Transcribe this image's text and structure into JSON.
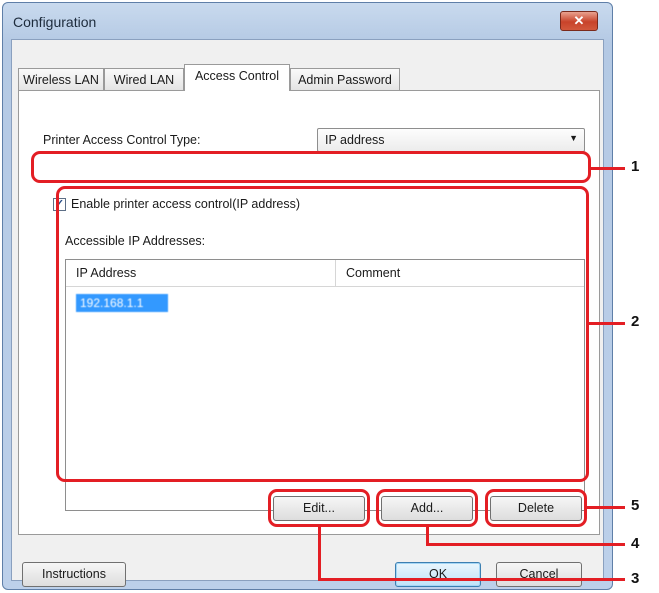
{
  "window": {
    "title": "Configuration",
    "close_glyph": "✕"
  },
  "tabs": [
    {
      "label": "Wireless LAN"
    },
    {
      "label": "Wired LAN"
    },
    {
      "label": "Access Control",
      "active": true
    },
    {
      "label": "Admin Password"
    }
  ],
  "access": {
    "type_label": "Printer Access Control Type:",
    "type_value": "IP address",
    "enable_label": "Enable printer access control(IP address)",
    "enable_checked": true,
    "list_label": "Accessible IP Addresses:",
    "columns": [
      "IP Address",
      "Comment"
    ],
    "rows": [
      {
        "ip": "192.168.1.1",
        "comment": ""
      }
    ]
  },
  "buttons": {
    "edit": "Edit...",
    "add": "Add...",
    "delete": "Delete",
    "instructions": "Instructions",
    "ok": "OK",
    "cancel": "Cancel"
  },
  "callouts": [
    "1",
    "2",
    "3",
    "4",
    "5"
  ],
  "colors": {
    "callout": "#e31e24",
    "selection": "#3399ff"
  }
}
